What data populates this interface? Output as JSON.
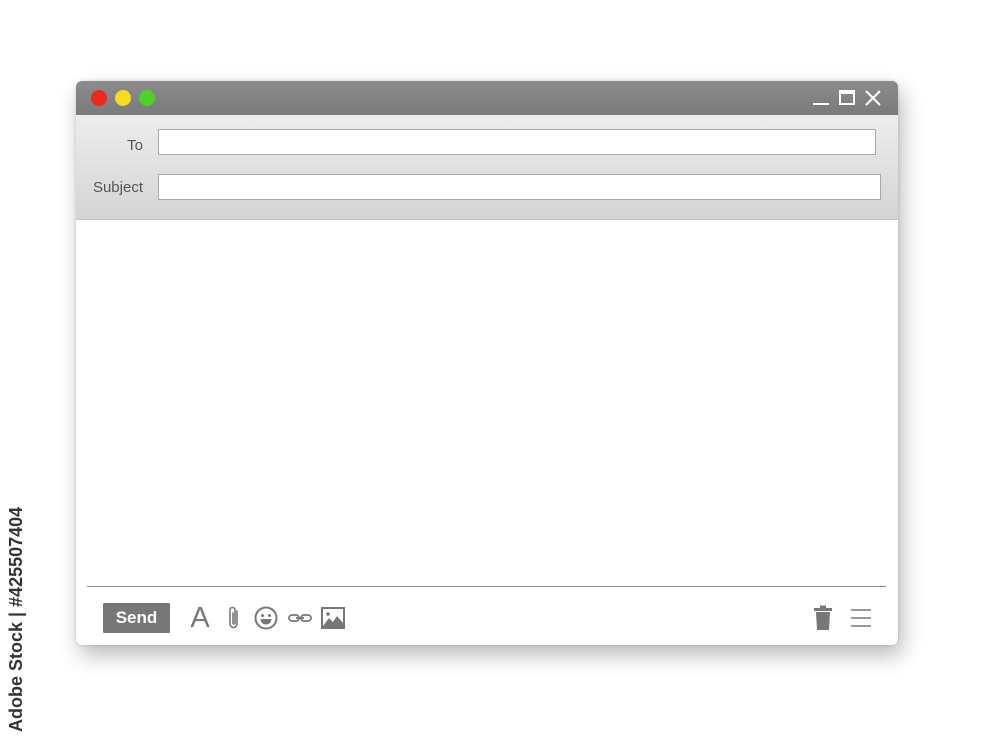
{
  "compose": {
    "to_label": "To",
    "to_value": "",
    "subject_label": "Subject",
    "subject_value": "",
    "body_value": ""
  },
  "toolbar": {
    "send_label": "Send",
    "font_glyph": "A",
    "icons": [
      "format-text-icon",
      "attachment-icon",
      "emoji-icon",
      "link-icon",
      "image-icon",
      "trash-icon",
      "menu-icon"
    ]
  },
  "window_controls": {
    "icons": [
      "close-dot",
      "minimize-dot",
      "maximize-dot",
      "minimize-icon",
      "maximize-icon",
      "close-icon"
    ],
    "dot_colors": [
      "#f1261c",
      "#f5dc1f",
      "#4fd226"
    ]
  },
  "watermark": {
    "text": "Adobe Stock | #425507404"
  },
  "colors": {
    "titlebar": "#7a7a7a",
    "header": "#e0e0e0",
    "send_button": "#777777",
    "icons": "#777777"
  }
}
